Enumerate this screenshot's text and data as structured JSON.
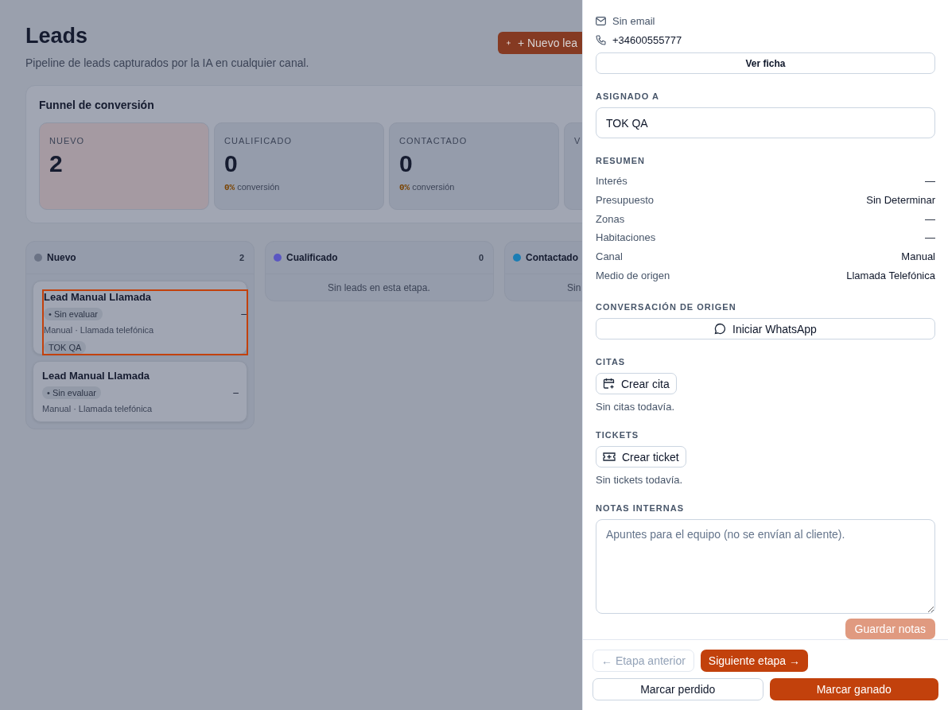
{
  "page": {
    "title": "Leads",
    "subtitle": "Pipeline de leads capturados por la IA en cualquier canal.",
    "new_button": "+ Nuevo lea"
  },
  "funnel": {
    "title": "Funnel de conversión",
    "stages": [
      {
        "label": "NUEVO",
        "count": "2",
        "selected": true
      },
      {
        "label": "CUALIFICADO",
        "count": "0",
        "percent": "0%",
        "suffix": "conversión",
        "selected": false
      },
      {
        "label": "CONTACTADO",
        "count": "0",
        "percent": "0%",
        "suffix": "conversión",
        "selected": false
      },
      {
        "label": "V",
        "selected": false
      }
    ]
  },
  "columns": [
    {
      "name": "Nuevo",
      "count": "2",
      "color": "#6b7385",
      "cards": [
        {
          "title": "Lead Manual Llamada",
          "score": "• Sin evaluar",
          "value": "–",
          "source": "Manual · Llamada telefónica",
          "assignee": "TOK QA",
          "selected": true
        },
        {
          "title": "Lead Manual Llamada",
          "score": "• Sin evaluar",
          "value": "–",
          "source": "Manual · Llamada telefónica",
          "selected": false
        }
      ]
    },
    {
      "name": "Cualificado",
      "count": "0",
      "color": "#5a56c2",
      "empty": "Sin leads en esta etapa."
    },
    {
      "name": "Contactado",
      "color": "#1b7db4",
      "empty": "Sin"
    }
  ],
  "drawer": {
    "contact": [
      {
        "kind": "email",
        "text": "Sin email",
        "muted": true
      },
      {
        "kind": "phone",
        "text": "+34600555777",
        "muted": false
      }
    ],
    "view_button": "Ver ficha",
    "assigned": {
      "label": "ASIGNADO A",
      "value": "TOK QA"
    },
    "summary": {
      "label": "RESUMEN",
      "rows": [
        {
          "key": "Interés",
          "value": "—"
        },
        {
          "key": "Presupuesto",
          "value": "Sin Determinar"
        },
        {
          "key": "Zonas",
          "value": "—"
        },
        {
          "key": "Habitaciones",
          "value": "—"
        },
        {
          "key": "Canal",
          "value": "Manual"
        },
        {
          "key": "Medio de origen",
          "value": "Llamada Telefónica"
        }
      ]
    },
    "conversation": {
      "label": "CONVERSACIÓN DE ORIGEN",
      "button": "Iniciar WhatsApp"
    },
    "appointments": {
      "label": "CITAS",
      "button": "Crear cita",
      "empty": "Sin citas todavía."
    },
    "tickets": {
      "label": "TICKETS",
      "button": "Crear ticket",
      "empty": "Sin tickets todavía."
    },
    "notes": {
      "label": "NOTAS INTERNAS",
      "placeholder": "Apuntes para el equipo (no se envían al cliente).",
      "button": "Guardar notas",
      "button_disabled": true
    },
    "footer": {
      "prev": "← Etapa anterior",
      "prev_disabled": true,
      "next": "Siguiente etapa →",
      "lost": "Marcar perdido",
      "won": "Marcar ganado"
    }
  }
}
